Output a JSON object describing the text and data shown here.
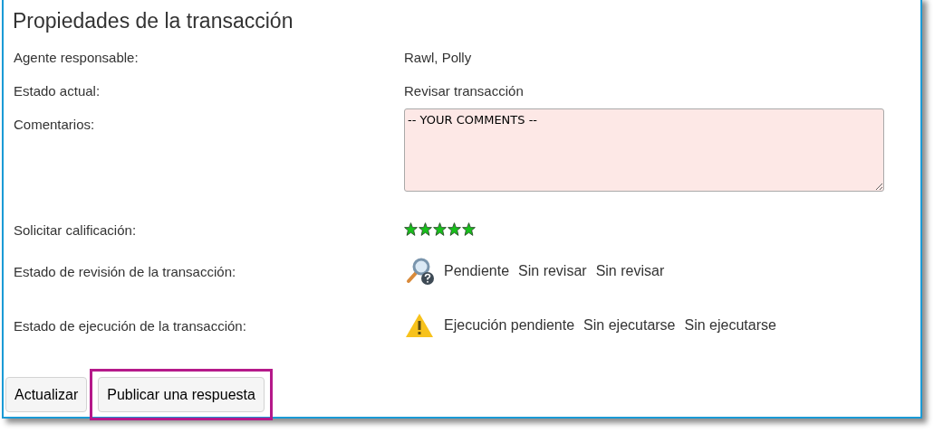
{
  "title": "Propiedades de la transacción",
  "fields": [
    {
      "kind": "text",
      "label": "Agente responsable:",
      "value": "Rawl, Polly"
    },
    {
      "kind": "text",
      "label": "Estado actual:",
      "value": "Revisar transacción"
    },
    {
      "kind": "textarea",
      "label": "Comentarios:",
      "value": "-- YOUR COMMENTS --"
    },
    {
      "kind": "rating",
      "label": "Solicitar calificación:",
      "stars": 5
    },
    {
      "kind": "review",
      "label": "Estado de revisión de la transacción:",
      "values": [
        "Pendiente",
        "Sin revisar",
        "Sin revisar"
      ]
    },
    {
      "kind": "execution",
      "label": "Estado de ejecución de la transacción:",
      "values": [
        "Ejecución pendiente",
        "Sin ejecutarse",
        "Sin ejecutarse"
      ]
    }
  ],
  "buttons": [
    {
      "label": "Actualizar",
      "highlighted": false
    },
    {
      "label": "Publicar una respuesta",
      "highlighted": true
    }
  ]
}
